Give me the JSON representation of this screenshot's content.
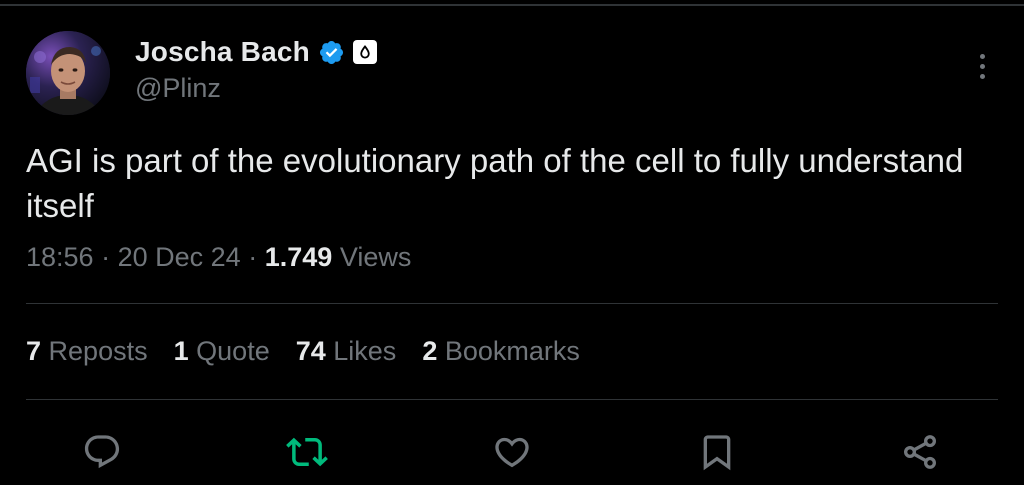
{
  "author": {
    "display_name": "Joscha Bach",
    "handle": "@Plinz"
  },
  "tweet": {
    "text": "AGI is part of the evolutionary path of the cell to fully understand itself"
  },
  "meta": {
    "time": "18:56",
    "date": "20 Dec 24",
    "views_count": "1.749",
    "views_label": "Views",
    "separator": "·"
  },
  "stats": {
    "reposts": {
      "count": "7",
      "label": "Reposts"
    },
    "quotes": {
      "count": "1",
      "label": "Quote"
    },
    "likes": {
      "count": "74",
      "label": "Likes"
    },
    "bookmarks": {
      "count": "2",
      "label": "Bookmarks"
    }
  },
  "colors": {
    "background": "#000000",
    "primary_text": "#e7e9ea",
    "secondary_text": "#71767b",
    "divider": "#2f3336",
    "verified_blue": "#1d9bf0",
    "repost_green": "#00ba7c"
  },
  "icons": {
    "verified": "verified-badge-icon",
    "affiliation": "affiliation-badge-icon",
    "more": "more-options-icon",
    "reply": "reply-icon",
    "repost": "repost-icon",
    "like": "like-icon",
    "bookmark": "bookmark-icon",
    "share": "share-icon"
  }
}
